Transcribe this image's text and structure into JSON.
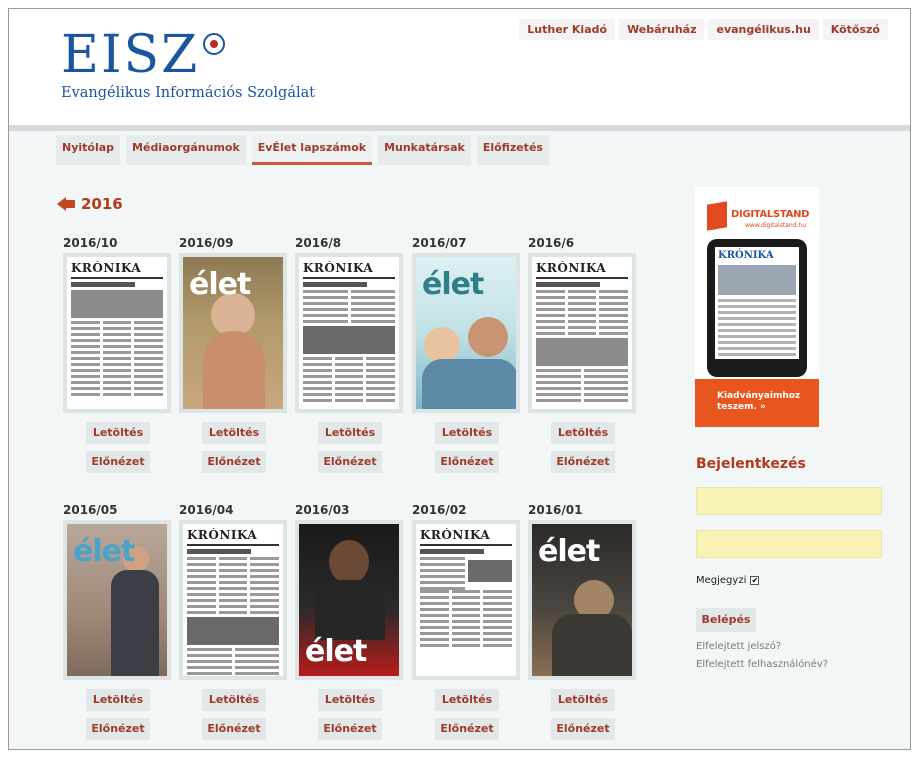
{
  "header": {
    "logo_text": "EISZ",
    "logo_subtitle": "Evangélikus Információs Szolgálat",
    "top_links": [
      "Luther Kiadó",
      "Webáruház",
      "evangélikus.hu",
      "Kötőszó"
    ]
  },
  "nav": {
    "tabs": [
      "Nyitólap",
      "Médiaorgánumok",
      "EvÉlet lapszámok",
      "Munkatársak",
      "Előfizetés"
    ],
    "active": "EvÉlet lapszámok"
  },
  "year": "2016",
  "buttons": {
    "download": "Letöltés",
    "preview": "Előnézet"
  },
  "issues": [
    {
      "title": "2016/10",
      "type": "kronika",
      "masthead": "KRÓNIKA"
    },
    {
      "title": "2016/09",
      "type": "elet",
      "masthead": "élet"
    },
    {
      "title": "2016/8",
      "type": "kronika",
      "masthead": "KRÓNIKA"
    },
    {
      "title": "2016/07",
      "type": "elet",
      "masthead": "élet"
    },
    {
      "title": "2016/6",
      "type": "kronika",
      "masthead": "KRÓNIKA"
    },
    {
      "title": "2016/05",
      "type": "elet",
      "masthead": "élet"
    },
    {
      "title": "2016/04",
      "type": "kronika",
      "masthead": "KRÓNIKA"
    },
    {
      "title": "2016/03",
      "type": "elet",
      "masthead": "élet"
    },
    {
      "title": "2016/02",
      "type": "kronika",
      "masthead": "KRÓNIKA"
    },
    {
      "title": "2016/01",
      "type": "elet",
      "masthead": "élet"
    }
  ],
  "ad": {
    "brand": "DIGITALSTAND",
    "url": "www.digitalstand.hu",
    "tablet_masthead": "KRÓNIKA",
    "cta": "Kiadványaimhoz teszem. »"
  },
  "login": {
    "title": "Bejelentkezés",
    "username_value": "",
    "password_value": "",
    "remember_label": "Megjegyzi",
    "remember_checked": true,
    "submit": "Belépés",
    "forgot_password": "Elfelejtett jelszó?",
    "forgot_username": "Elfelejtett felhasználónév?"
  }
}
